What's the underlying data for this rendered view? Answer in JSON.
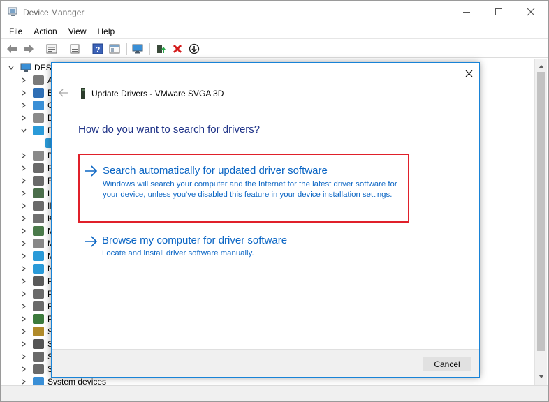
{
  "window": {
    "title": "Device Manager",
    "menu": [
      "File",
      "Action",
      "View",
      "Help"
    ]
  },
  "toolbar": {
    "icons": [
      "back-icon",
      "forward-icon",
      "properties-icon",
      "details-icon",
      "help-icon",
      "view-icon",
      "monitor-icon",
      "update-driver-icon",
      "uninstall-icon",
      "scan-icon"
    ]
  },
  "tree": {
    "root_label": "DESK",
    "nodes": [
      {
        "label": "A",
        "color": "#7a7a7a"
      },
      {
        "label": "B",
        "color": "#2f6fb5"
      },
      {
        "label": "C",
        "color": "#3a8fd6"
      },
      {
        "label": "D",
        "color": "#8a8a8a"
      },
      {
        "label": "D",
        "color": "#2a9ad8"
      },
      {
        "label": "",
        "color": "#2a9ad8"
      },
      {
        "label": "D",
        "color": "#8a8a8a"
      },
      {
        "label": "F",
        "color": "#6a6a6a"
      },
      {
        "label": "F",
        "color": "#6a6a6a"
      },
      {
        "label": "H",
        "color": "#4b6e4b"
      },
      {
        "label": "ID",
        "color": "#6a6a6a"
      },
      {
        "label": "K",
        "color": "#707070"
      },
      {
        "label": "M",
        "color": "#4a7a4a"
      },
      {
        "label": "M",
        "color": "#888888"
      },
      {
        "label": "M",
        "color": "#2a9ad8"
      },
      {
        "label": "N",
        "color": "#2a9ad8"
      },
      {
        "label": "P",
        "color": "#5a5a5a"
      },
      {
        "label": "P",
        "color": "#6a6a6a"
      },
      {
        "label": "P",
        "color": "#6a6a6a"
      },
      {
        "label": "P",
        "color": "#3c7a3c"
      },
      {
        "label": "S",
        "color": "#b08a2a"
      },
      {
        "label": "S",
        "color": "#555555"
      },
      {
        "label": "S",
        "color": "#6a6a6a"
      },
      {
        "label": "S",
        "color": "#6a6a6a"
      },
      {
        "label": "System devices",
        "color": "#3a8fd6"
      }
    ]
  },
  "dialog": {
    "title": "Update Drivers - VMware SVGA 3D",
    "heading": "How do you want to search for drivers?",
    "options": [
      {
        "title": "Search automatically for updated driver software",
        "description": "Windows will search your computer and the Internet for the latest driver software for your device, unless you've disabled this feature in your device installation settings."
      },
      {
        "title": "Browse my computer for driver software",
        "description": "Locate and install driver software manually."
      }
    ],
    "cancel_label": "Cancel",
    "highlight_color": "#e0202a",
    "accent_color": "#0c66c4"
  }
}
